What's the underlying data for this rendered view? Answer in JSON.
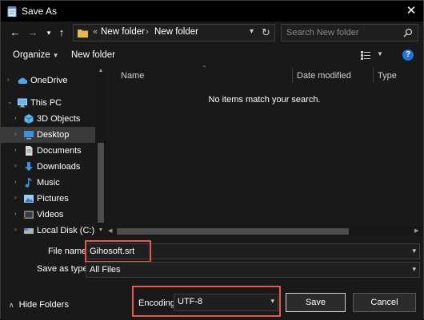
{
  "window": {
    "title": "Save As",
    "close_glyph": "✕"
  },
  "nav": {
    "back_glyph": "←",
    "forward_glyph": "→",
    "recent_glyph": "▾",
    "up_glyph": "↑",
    "address": {
      "chevron": "«",
      "crumbs": [
        "New folder",
        "New folder"
      ],
      "separator": "›",
      "dropdown_glyph": "▾",
      "refresh_glyph": "↻"
    },
    "search": {
      "placeholder": "Search New folder"
    }
  },
  "toolbar": {
    "organize_label": "Organize",
    "new_folder_label": "New folder",
    "help_glyph": "?"
  },
  "sidebar": {
    "items": [
      {
        "label": "OneDrive",
        "icon": "cloud-icon",
        "color": "#4fa3e9"
      },
      {
        "label": "This PC",
        "icon": "computer-icon",
        "color": "#6ab5f0"
      },
      {
        "label": "3D Objects",
        "icon": "cube-icon",
        "color": "#5fb8ea"
      },
      {
        "label": "Desktop",
        "icon": "desktop-icon",
        "color": "#3d8fe0",
        "selected": true
      },
      {
        "label": "Documents",
        "icon": "document-icon",
        "color": "#cfcfcf"
      },
      {
        "label": "Downloads",
        "icon": "download-icon",
        "color": "#3d8fe0"
      },
      {
        "label": "Music",
        "icon": "music-icon",
        "color": "#3d8fe0"
      },
      {
        "label": "Pictures",
        "icon": "pictures-icon",
        "color": "#9ec7ee"
      },
      {
        "label": "Videos",
        "icon": "video-icon",
        "color": "#9a9a9a"
      },
      {
        "label": "Local Disk (C:)",
        "icon": "disk-icon",
        "color": "#b0b0b0"
      }
    ]
  },
  "file_list": {
    "columns": [
      "Name",
      "Date modified",
      "Type"
    ],
    "empty_message": "No items match your search."
  },
  "form": {
    "file_name_label": "File name:",
    "file_name_value": "Gihosoft.srt",
    "save_as_type_label": "Save as type:",
    "save_as_type_value": "All Files",
    "encoding_label": "Encoding:",
    "encoding_value": "UTF-8",
    "dropdown_glyph": "▾"
  },
  "footer": {
    "hide_folders_label": "Hide Folders",
    "save_label": "Save",
    "cancel_label": "Cancel"
  },
  "colors": {
    "highlight": "#e8554e",
    "accent": "#1e76d7",
    "folder": "#e8b84a"
  }
}
